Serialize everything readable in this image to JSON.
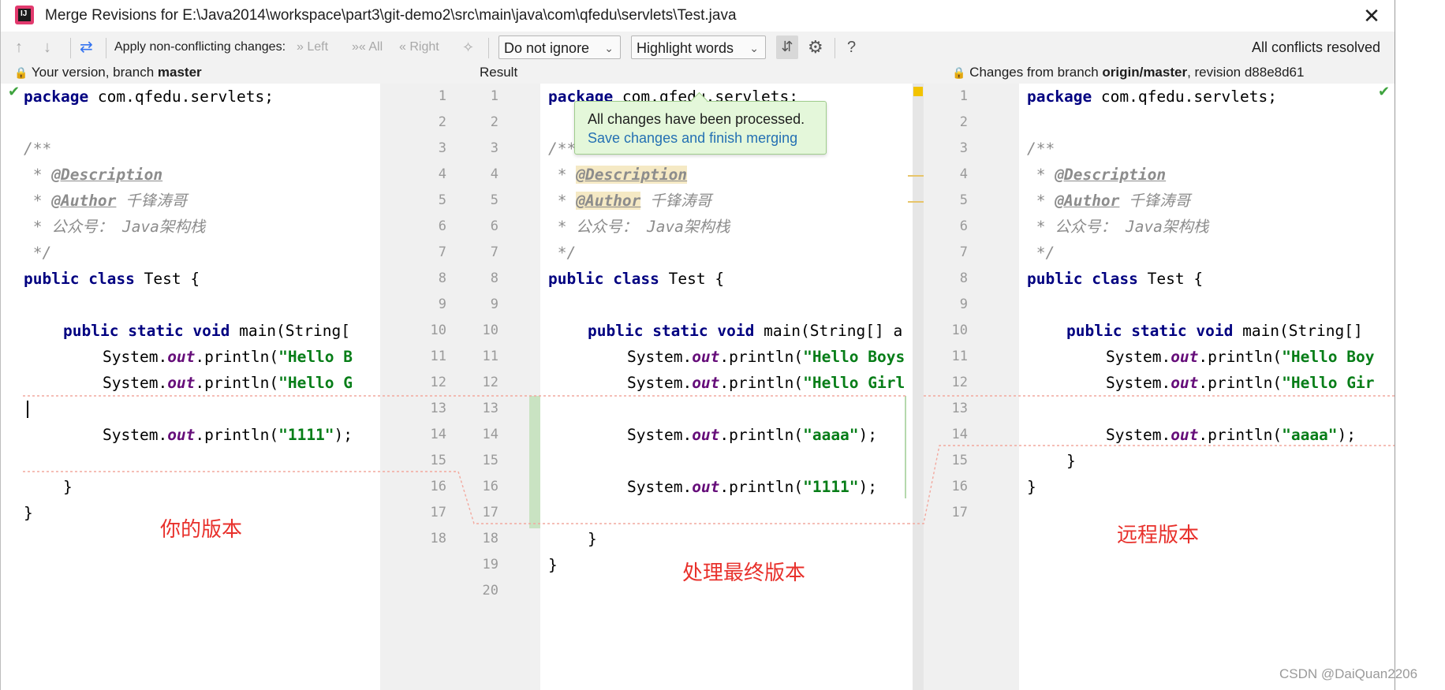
{
  "window": {
    "title": "Merge Revisions for E:\\Java2014\\workspace\\part3\\git-demo2\\src\\main\\java\\com\\qfedu\\servlets\\Test.java",
    "close_glyph": "✕"
  },
  "toolbar": {
    "apply_label": "Apply non-conflicting changes:",
    "left_label": "Left",
    "all_label": "All",
    "right_label": "Right",
    "whitespace_combo": "Do not ignore",
    "highlight_combo": "Highlight words",
    "help_glyph": "?",
    "status": "All conflicts resolved"
  },
  "headers": {
    "left_prefix": "Your version, branch ",
    "left_branch": "master",
    "center": "Result",
    "right_prefix": "Changes from branch ",
    "right_branch": "origin/master",
    "right_suffix": ", revision d88e8d61"
  },
  "popup": {
    "message": "All changes have been processed.",
    "link": "Save changes and finish merging"
  },
  "gutter": {
    "left_numbers": [
      "1",
      "2",
      "3",
      "4",
      "5",
      "6",
      "7",
      "8",
      "9",
      "10",
      "11",
      "12",
      "13",
      "14",
      "15",
      "16",
      "17",
      "18"
    ],
    "result_numbers": [
      "1",
      "2",
      "3",
      "4",
      "5",
      "6",
      "7",
      "8",
      "9",
      "10",
      "11",
      "12",
      "13",
      "14",
      "15",
      "16",
      "17",
      "18",
      "19",
      "20"
    ],
    "right_numbers": [
      "1",
      "2",
      "3",
      "4",
      "5",
      "6",
      "7",
      "8",
      "9",
      "10",
      "11",
      "12",
      "13",
      "14",
      "15",
      "16",
      "17"
    ]
  },
  "code": {
    "package_kw": "package",
    "package_name": " com.qfedu.servlets;",
    "doc_open": "/**",
    "doc_star": " * ",
    "tag_desc": "@Description",
    "tag_author": "@Author",
    "author_name": " 千锋涛哥",
    "wechat_line": " * 公众号： Java架构栈",
    "doc_close": " */",
    "public_kw": "public",
    "class_kw": " class",
    "class_name": " Test {",
    "static_kw": " static",
    "void_kw": " void",
    "main_left": " main(String[",
    "main_result": " main(String[] a",
    "main_right": " main(String[]",
    "system": "System.",
    "out": "out",
    "println": ".println(",
    "str_boys_left": "\"Hello B",
    "str_girls_left": "\"Hello G",
    "str_boys_result": "\"Hello Boys",
    "str_girls_result": "\"Hello Girl",
    "str_boys_right": "\"Hello Boy",
    "str_girls_right": "\"Hello Gir",
    "str_1111": "\"1111\"",
    "str_aaaa": "\"aaaa\"",
    "call_end": ");",
    "close_brace": "}"
  },
  "annotations": {
    "left": "你的版本",
    "center": "处理最终版本",
    "right": "远程版本"
  },
  "watermark": "CSDN @DaiQuan2206",
  "colors": {
    "keyword": "#000080",
    "string": "#067d17",
    "comment": "#8c8c8c",
    "annotation_red": "#e8302b",
    "popup_bg": "#e4f7da",
    "link_blue": "#2470b3",
    "added_green": "#c9e3c2"
  }
}
